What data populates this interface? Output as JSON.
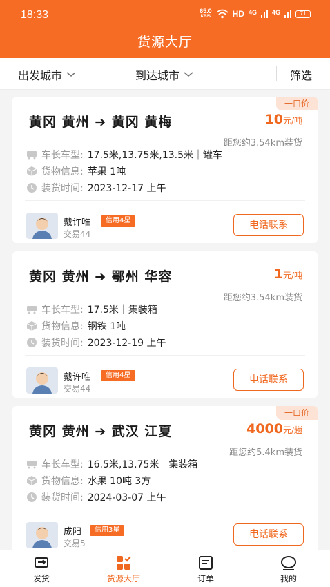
{
  "status": {
    "time": "18:33",
    "net_speed": "65.0",
    "net_unit": "KB/S",
    "hd": "HD",
    "sig1": "4G",
    "sig2": "4G",
    "battery": "71"
  },
  "header": {
    "title": "货源大厅"
  },
  "filters": {
    "from": "出发城市",
    "to": "到达城市",
    "filter": "筛选"
  },
  "labels": {
    "vehicle": "车长车型:",
    "goods": "货物信息:",
    "load_time": "装货时间:",
    "call": "电话联系"
  },
  "cards": [
    {
      "badge": "一口价",
      "route": "黄冈 黄州 ➔ 黄冈 黄梅",
      "price": "10",
      "unit": "元/吨",
      "distance": "距您约3.54km装货",
      "vehicle": "17.5米,13.75米,13.5米｜罐车",
      "goods": "苹果 1吨",
      "load_time": "2023-12-17 上午",
      "user": "戴许唯",
      "credit": "信用4星",
      "trades": "交易44"
    },
    {
      "badge": "",
      "route": "黄冈 黄州 ➔ 鄂州 华容",
      "price": "1",
      "unit": "元/吨",
      "distance": "距您约3.54km装货",
      "vehicle": "17.5米｜集装箱",
      "goods": "钢铁 1吨",
      "load_time": "2023-12-19 上午",
      "user": "戴许唯",
      "credit": "信用4星",
      "trades": "交易44"
    },
    {
      "badge": "一口价",
      "route": "黄冈 黄州 ➔ 武汉 江夏",
      "price": "4000",
      "unit": "元/趟",
      "distance": "距您约5.4km装货",
      "vehicle": "16.5米,13.75米｜集装箱",
      "goods": "水果 10吨 3方",
      "load_time": "2024-03-07 上午",
      "user": "成阳",
      "credit": "信用3星",
      "trades": "交易5"
    }
  ],
  "tabs": [
    {
      "label": "发货",
      "icon": "truck-icon",
      "active": false
    },
    {
      "label": "货源大厅",
      "icon": "cargo-hall-icon",
      "active": true
    },
    {
      "label": "订单",
      "icon": "order-icon",
      "active": false
    },
    {
      "label": "我的",
      "icon": "profile-icon",
      "active": false
    }
  ],
  "colors": {
    "brand": "#f66c24",
    "price": "#f0681f",
    "badge_bg": "#fde3d5"
  }
}
